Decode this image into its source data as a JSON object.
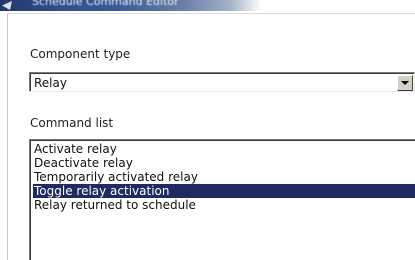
{
  "window": {
    "title": "Schedule Command Editor"
  },
  "form": {
    "component_type_label": "Component type",
    "component_type_value": "Relay",
    "command_list_label": "Command list",
    "commands": [
      "Activate relay",
      "Deactivate relay",
      "Temporarily activated relay",
      "Toggle relay activation",
      "Relay returned to schedule"
    ],
    "selected_index": 3
  },
  "colors": {
    "selection_background": "#1f2a63",
    "selection_text": "#ffffff",
    "titlebar": "#2c4a86"
  },
  "icons": {
    "dropdown": "chevron-down-icon",
    "window": "window-icon"
  }
}
